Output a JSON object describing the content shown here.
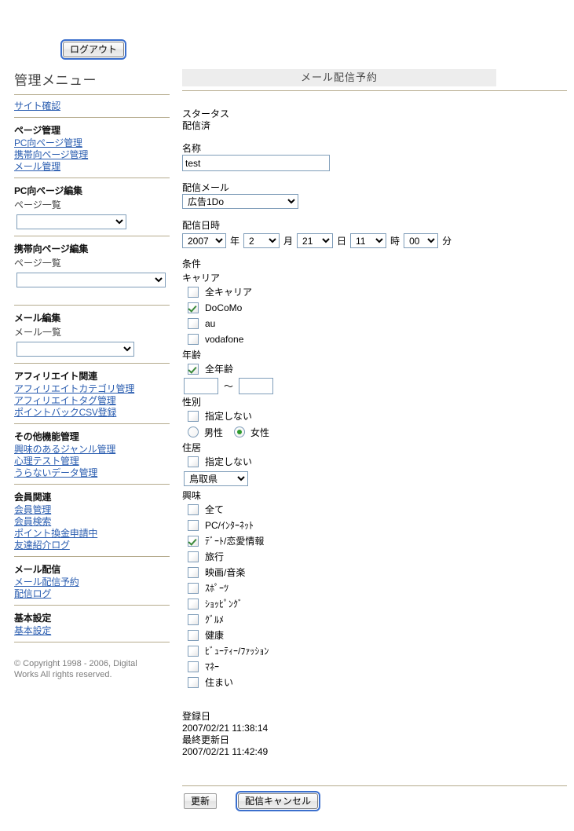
{
  "topbar": {
    "logout_label": "ログアウト"
  },
  "sidebar": {
    "title": "管理メニュー",
    "site_check": "サイト確認",
    "groups": [
      {
        "heading": "ページ管理",
        "links": [
          "PC向ページ管理",
          "携帯向ページ管理",
          "メール管理"
        ]
      },
      {
        "heading": "アフィリエイト関連",
        "links": [
          "アフィリエイトカテゴリ管理",
          "アフィリエイトタグ管理",
          "ポイントバックCSV登録"
        ]
      },
      {
        "heading": "その他機能管理",
        "links": [
          "興味のあるジャンル管理",
          "心理テスト管理",
          "うらないデータ管理"
        ]
      },
      {
        "heading": "会員関連",
        "links": [
          "会員管理",
          "会員検索",
          "ポイント換金申請中",
          "友達紹介ログ"
        ]
      },
      {
        "heading": "メール配信",
        "links": [
          "メール配信予約",
          "配信ログ"
        ]
      },
      {
        "heading": "基本設定",
        "links": [
          "基本設定"
        ]
      }
    ],
    "pc_edit": {
      "heading": "PC向ページ編集",
      "sub": "ページ一覧",
      "selected": ""
    },
    "mobile_edit": {
      "heading": "携帯向ページ編集",
      "sub": "ページ一覧",
      "selected": ""
    },
    "mail_edit": {
      "heading": "メール編集",
      "sub": "メール一覧",
      "selected": ""
    },
    "copyright": "© Copyright 1998 - 2006, Digital Works All rights reserved."
  },
  "main": {
    "page_title": "メール配信予約",
    "status_label": "スタータス",
    "status_value": "配信済",
    "name_label": "名称",
    "name_value": "test",
    "mail_label": "配信メール",
    "mail_selected": "広告1Do",
    "datetime_label": "配信日時",
    "datetime": {
      "year": "2007",
      "year_unit": "年",
      "month": "2",
      "month_unit": "月",
      "day": "21",
      "day_unit": "日",
      "hour": "11",
      "hour_unit": "時",
      "minute": "00",
      "minute_unit": "分"
    },
    "condition_label": "条件",
    "carrier": {
      "label": "キャリア",
      "items": [
        {
          "label": "全キャリア",
          "checked": false
        },
        {
          "label": "DoCoMo",
          "checked": true
        },
        {
          "label": "au",
          "checked": false
        },
        {
          "label": "vodafone",
          "checked": false
        }
      ]
    },
    "age": {
      "label": "年齢",
      "all_label": "全年齢",
      "all_checked": true,
      "from": "",
      "to": "",
      "range_sep": "〜"
    },
    "gender": {
      "label": "性別",
      "unspecified_label": "指定しない",
      "unspecified_checked": false,
      "male_label": "男性",
      "male_selected": false,
      "female_label": "女性",
      "female_selected": true
    },
    "residence": {
      "label": "住居",
      "unspecified_label": "指定しない",
      "unspecified_checked": false,
      "prefecture_selected": "鳥取県"
    },
    "interest": {
      "label": "興味",
      "items": [
        {
          "label": "全て",
          "checked": false
        },
        {
          "label": "PC/ｲﾝﾀｰﾈｯﾄ",
          "checked": false
        },
        {
          "label": "ﾃﾞｰﾄ/恋愛情報",
          "checked": true
        },
        {
          "label": "旅行",
          "checked": false
        },
        {
          "label": "映画/音楽",
          "checked": false
        },
        {
          "label": "ｽﾎﾟｰﾂ",
          "checked": false
        },
        {
          "label": "ｼｮｯﾋﾟﾝｸﾞ",
          "checked": false
        },
        {
          "label": "ｸﾞﾙﾒ",
          "checked": false
        },
        {
          "label": "健康",
          "checked": false
        },
        {
          "label": "ﾋﾞｭｰﾃｨｰ/ﾌｧｯｼｮﾝ",
          "checked": false
        },
        {
          "label": "ﾏﾈｰ",
          "checked": false
        },
        {
          "label": "住まい",
          "checked": false
        }
      ]
    },
    "registered_label": "登録日",
    "registered_value": "2007/02/21 11:38:14",
    "updated_label": "最終更新日",
    "updated_value": "2007/02/21 11:42:49"
  },
  "footer": {
    "update_label": "更新",
    "cancel_label": "配信キャンセル"
  },
  "colors": {
    "link": "#2a5db0",
    "rule": "#b5ab8d",
    "title_bar_bg": "#ededed",
    "input_border": "#7f9db9",
    "check_green": "#3b8a3b"
  }
}
